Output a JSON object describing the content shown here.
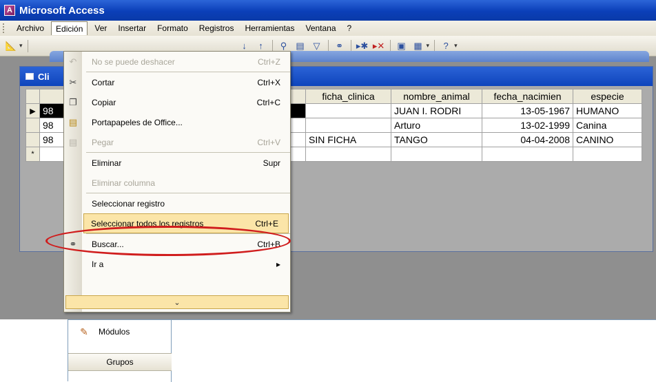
{
  "app": {
    "title": "Microsoft Access"
  },
  "menubar": {
    "items": [
      {
        "label": "Archivo"
      },
      {
        "label": "Edición"
      },
      {
        "label": "Ver"
      },
      {
        "label": "Insertar"
      },
      {
        "label": "Formato"
      },
      {
        "label": "Registros"
      },
      {
        "label": "Herramientas"
      },
      {
        "label": "Ventana"
      },
      {
        "label": "?"
      }
    ]
  },
  "table_window": {
    "title": "Cli"
  },
  "grid": {
    "columns": [
      "",
      "ficha_clinica",
      "nombre_animal",
      "fecha_nacimien",
      "especie"
    ],
    "rows": [
      {
        "selector": "▶",
        "id": "98",
        "ficha": "",
        "nombre": "JUAN I. RODRI",
        "fecha": "13-05-1967",
        "especie": "HUMANO"
      },
      {
        "selector": "",
        "id": "98",
        "ficha": "",
        "nombre": "Arturo",
        "fecha": "13-02-1999",
        "especie": "Canina"
      },
      {
        "selector": "",
        "id": "98",
        "ficha": "SIN FICHA",
        "nombre": "TANGO",
        "fecha": "04-04-2008",
        "especie": "CANINO"
      },
      {
        "selector": "*",
        "id": "",
        "ficha": "",
        "nombre": "",
        "fecha": "",
        "especie": ""
      }
    ]
  },
  "edit_menu": {
    "items": [
      {
        "label": "No se puede deshacer",
        "shortcut": "Ctrl+Z",
        "icon": "undo-icon",
        "disabled": true
      },
      {
        "label": "Cortar",
        "shortcut": "Ctrl+X",
        "icon": "scissors-icon"
      },
      {
        "label": "Copiar",
        "shortcut": "Ctrl+C",
        "icon": "copy-icon"
      },
      {
        "label": "Portapapeles de Office...",
        "shortcut": "",
        "icon": "clipboard-icon"
      },
      {
        "label": "Pegar",
        "shortcut": "Ctrl+V",
        "icon": "paste-icon",
        "disabled": true
      },
      {
        "label": "Eliminar",
        "shortcut": "Supr",
        "icon": ""
      },
      {
        "label": "Eliminar columna",
        "shortcut": "",
        "icon": "",
        "disabled": true
      },
      {
        "label": "Seleccionar registro",
        "shortcut": "",
        "icon": ""
      },
      {
        "label": "Seleccionar todos los registros",
        "shortcut": "Ctrl+E",
        "icon": "",
        "highlighted": true
      },
      {
        "label": "Buscar...",
        "shortcut": "Ctrl+B",
        "icon": "binoculars-icon"
      },
      {
        "label": "Ir a",
        "shortcut": "▸",
        "icon": ""
      }
    ],
    "expand_glyph": "⌄"
  },
  "nav_panel": {
    "modules_label": "Módulos",
    "groups_label": "Grupos"
  },
  "annotation_color": "#d01d1d"
}
